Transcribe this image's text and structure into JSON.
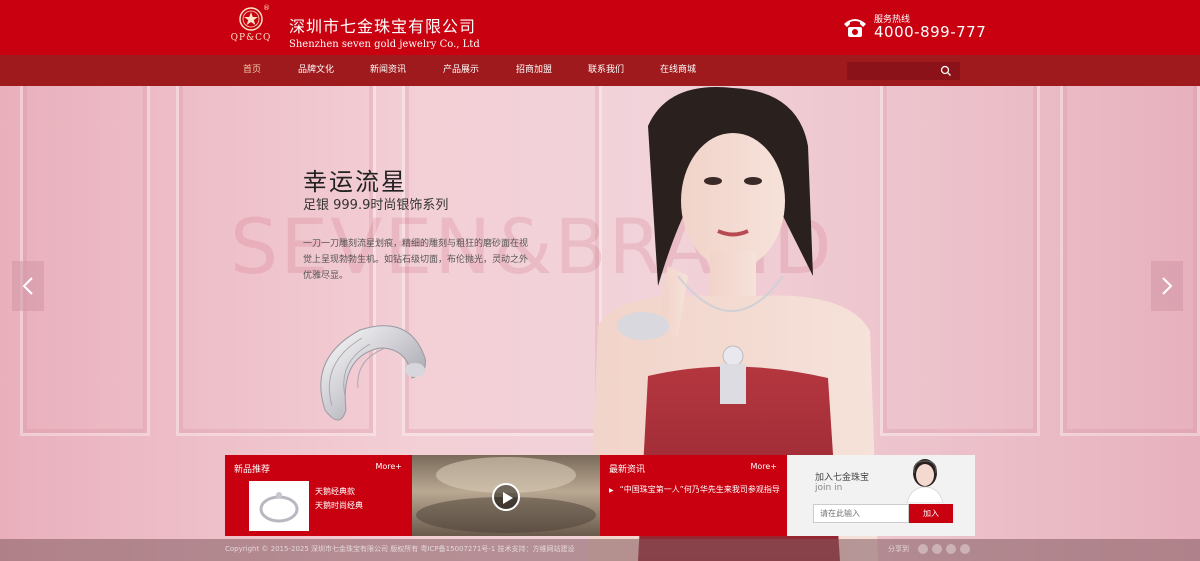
{
  "header": {
    "logo_text": "QP&CQ",
    "logo_reg": "®",
    "company_cn": "深圳市七金珠宝有限公司",
    "company_en": "Shenzhen seven gold jewelry Co., Ltd",
    "hotline_label": "服务热线",
    "hotline_number": "4000-899-777"
  },
  "nav": {
    "items": [
      "首页",
      "品牌文化",
      "新闻资讯",
      "产品展示",
      "招商加盟",
      "联系我们",
      "在线商城"
    ],
    "active_index": 0
  },
  "search": {
    "placeholder": ""
  },
  "hero": {
    "title": "幸运流星",
    "subtitle": "足银 999.9时尚银饰系列",
    "description": "一刀一刀雕刻流星划痕，精细的雕刻与粗狂的磨砂面在视觉上呈现勃勃生机。如钻石级切面，布伦抛光，灵动之外优雅尽显。",
    "watermark": "SEVEN&BRAND"
  },
  "new_products": {
    "title": "新品推荐",
    "more": "More+",
    "item_name": "天鹅经典款",
    "item_desc": "天鹅时尚经典"
  },
  "news": {
    "title": "最新资讯",
    "more": "More+",
    "item": "“中国珠宝第一人”何乃华先生来我司参观指导"
  },
  "join": {
    "title_cn": "加入七金珠宝",
    "title_en": "join in",
    "input_placeholder": "请在此输入",
    "button": "加入"
  },
  "footer": {
    "copyright": "Copyright © 2015-2025 深圳市七金珠宝有限公司 版权所有 粤ICP备15007271号-1   技术支持：方维网站建设",
    "share_label": "分享到"
  },
  "colors": {
    "brand_red": "#c8000f",
    "nav_red": "#9e1a1c"
  }
}
